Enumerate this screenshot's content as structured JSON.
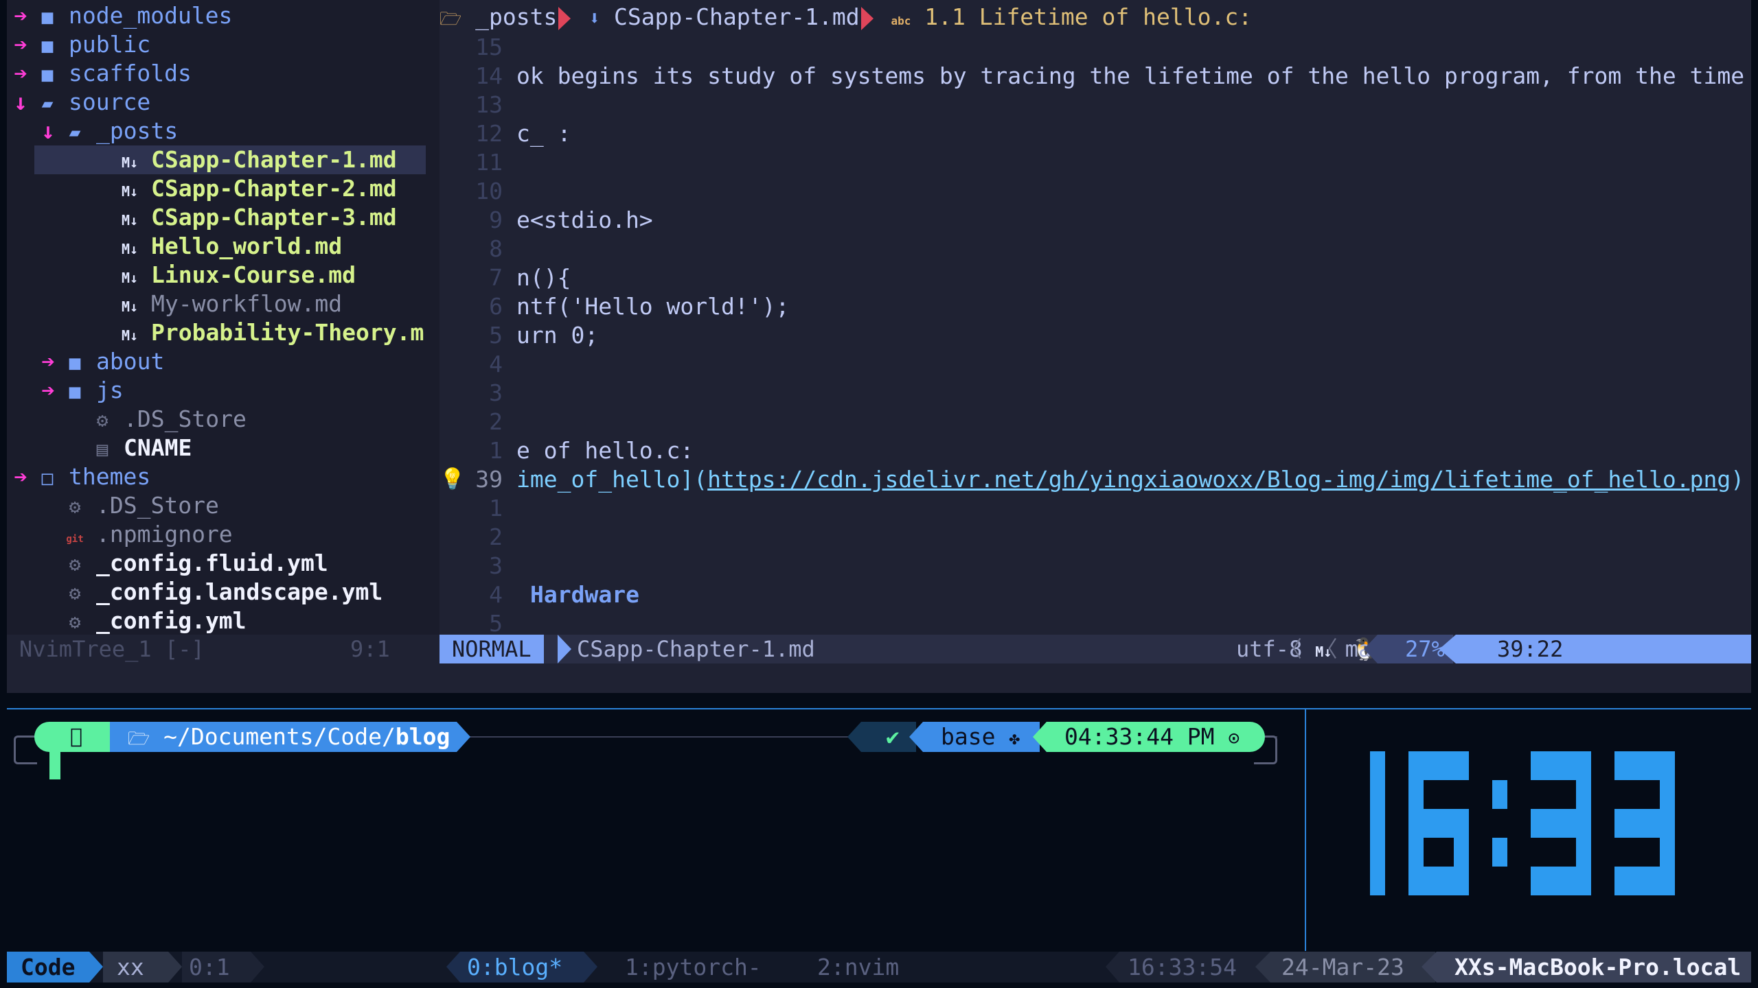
{
  "tree": {
    "items": [
      {
        "arrow": "➔",
        "icon": "folder",
        "name": "node_modules",
        "style": "dir",
        "indent": 0
      },
      {
        "arrow": "➔",
        "icon": "folder",
        "name": "public",
        "style": "dir",
        "indent": 0
      },
      {
        "arrow": "➔",
        "icon": "folder",
        "name": "scaffolds",
        "style": "dir",
        "indent": 0
      },
      {
        "arrow": "➔",
        "icon": "folder-open",
        "name": "source",
        "style": "dir",
        "indent": 0,
        "open": true
      },
      {
        "arrow": "➔",
        "icon": "folder-open",
        "name": "_posts",
        "style": "dir",
        "indent": 1,
        "open": true
      },
      {
        "icon": "markdown",
        "name": "CSapp-Chapter-1.md",
        "style": "bold",
        "indent": 2,
        "selected": true
      },
      {
        "icon": "markdown",
        "name": "CSapp-Chapter-2.md",
        "style": "bold",
        "indent": 2
      },
      {
        "icon": "markdown",
        "name": "CSapp-Chapter-3.md",
        "style": "bold",
        "indent": 2
      },
      {
        "icon": "markdown",
        "name": "Hello_world.md",
        "style": "bold",
        "indent": 2
      },
      {
        "icon": "markdown",
        "name": "Linux-Course.md",
        "style": "bold",
        "indent": 2
      },
      {
        "icon": "markdown",
        "name": "My-workflow.md",
        "style": "dim",
        "indent": 2
      },
      {
        "icon": "markdown",
        "name": "Probability-Theory.m",
        "style": "bold",
        "indent": 2
      },
      {
        "arrow": "➔",
        "icon": "folder",
        "name": "about",
        "style": "dir",
        "indent": 1
      },
      {
        "arrow": "➔",
        "icon": "folder",
        "name": "js",
        "style": "dir",
        "indent": 1
      },
      {
        "icon": "gear",
        "name": ".DS_Store",
        "style": "dim",
        "indent": 1
      },
      {
        "icon": "file",
        "name": "CNAME",
        "style": "white-bold",
        "indent": 1
      },
      {
        "arrow": "➔",
        "icon": "folder-outline",
        "name": "themes",
        "style": "dir",
        "indent": 0
      },
      {
        "icon": "gear",
        "name": ".DS_Store",
        "style": "dim",
        "indent": 0
      },
      {
        "icon": "git",
        "name": ".npmignore",
        "style": "dim",
        "indent": 0
      },
      {
        "icon": "gear",
        "name": "_config.fluid.yml",
        "style": "white-bold",
        "indent": 0
      },
      {
        "icon": "gear",
        "name": "_config.landscape.yml",
        "style": "white-bold",
        "indent": 0
      },
      {
        "icon": "gear",
        "name": "_config.yml",
        "style": "white-bold",
        "indent": 0
      }
    ],
    "status_name": "NvimTree_1 [-]",
    "status_pos": "9:1"
  },
  "winbar": {
    "folder": "_posts",
    "file": "CSapp-Chapter-1.md",
    "heading": "1.1 Lifetime of hello.c:"
  },
  "editor": {
    "lines": [
      {
        "num": "15",
        "text": ""
      },
      {
        "num": "14",
        "text": "ok begins its study of systems by tracing the lifetime of the hello program, from the time"
      },
      {
        "num": "13",
        "text": ""
      },
      {
        "num": "12",
        "text": "c_ :"
      },
      {
        "num": "11",
        "text": ""
      },
      {
        "num": "10",
        "text": ""
      },
      {
        "num": "9",
        "text": "e<stdio.h>"
      },
      {
        "num": "8",
        "text": ""
      },
      {
        "num": "7",
        "text": "n(){"
      },
      {
        "num": "6",
        "text": "ntf('Hello world!');"
      },
      {
        "num": "5",
        "text": "urn 0;"
      },
      {
        "num": "4",
        "text": ""
      },
      {
        "num": "3",
        "text": ""
      },
      {
        "num": "2",
        "text": ""
      },
      {
        "num": "1",
        "text": "e of hello.c:"
      },
      {
        "num": "39",
        "text": "ime_of_hello](https://cdn.jsdelivr.net/gh/yingxiaowoxx/Blog-img/img/lifetime_of_hello.png)",
        "current": true,
        "link_alt": "ime_of_hello",
        "link_url": "https://cdn.jsdelivr.net/gh/yingxiaowoxx/Blog-img/img/lifetime_of_hello.png"
      },
      {
        "num": "1",
        "text": ""
      },
      {
        "num": "2",
        "text": ""
      },
      {
        "num": "3",
        "text": ""
      },
      {
        "num": "4",
        "text": "Hardware",
        "heading": true
      },
      {
        "num": "5",
        "text": ""
      }
    ]
  },
  "statusline": {
    "mode": "NORMAL",
    "file": "CSapp-Chapter-1.md",
    "encoding": "utf-8",
    "filetype": "markdown",
    "percent": "27%",
    "position": "39:22"
  },
  "terminal": {
    "path_prefix": "~/Documents/Code/",
    "path_dir": "blog",
    "status": "✔",
    "env": "base",
    "time": "04:33:44 PM"
  },
  "clock": {
    "text": "16:33",
    "color": "#2d9bf0"
  },
  "tmux": {
    "session": "Code",
    "user": "xx",
    "pane": "0:1",
    "windows": [
      "0:blog*",
      "1:pytorch-",
      "2:nvim"
    ],
    "time": "16:33:54",
    "date": "24-Mar-23",
    "host": "XXs-MacBook-Pro.local"
  },
  "colors": {
    "accent": "#7aa2f7",
    "arrow": "#ff3dd7",
    "bold_file": "#d6f28c",
    "prompt_green": "#5cf0a0",
    "prompt_blue": "#3d8de8"
  }
}
